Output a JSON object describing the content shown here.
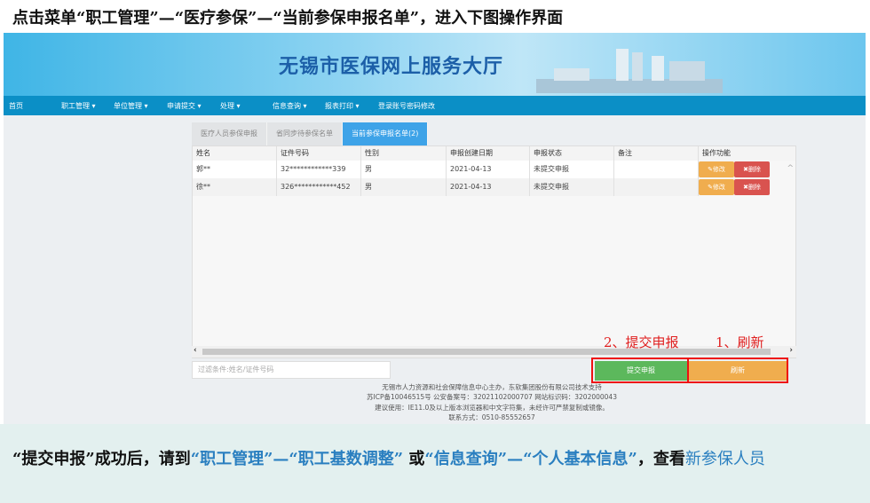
{
  "top_title": "点击菜单“职工管理”—“医疗参保”—“当前参保申报名单”，进入下图操作界面",
  "banner_title": "无锡市医保网上服务大厅",
  "nav": [
    "首页",
    "职工管理 ▾",
    "单位管理 ▾",
    "申请提交 ▾",
    "处理 ▾",
    "信息查询 ▾",
    "报表打印 ▾",
    "登录账号密码修改"
  ],
  "tabs": [
    "医疗人员参保申报",
    "省同步待参保名单",
    "当前参保申报名单(2)"
  ],
  "columns": [
    "姓名",
    "证件号码",
    "性别",
    "申报创建日期",
    "申报状态",
    "备注",
    "操作功能"
  ],
  "rows": [
    {
      "name": "郭**",
      "id": "32************339",
      "gender": "男",
      "date": "2021-04-13",
      "status": "未提交申报",
      "note": ""
    },
    {
      "name": "徐**",
      "id": "326************452",
      "gender": "男",
      "date": "2021-04-13",
      "status": "未提交申报",
      "note": ""
    }
  ],
  "edit_label": "✎修改",
  "delete_label": "✖删除",
  "filter_placeholder": "过滤条件:姓名/证件号码",
  "submit_label": "提交申报",
  "refresh_label": "刷新",
  "annot_submit": "2、提交申报",
  "annot_refresh": "1、刷新",
  "footer": [
    "无锡市人力资源和社会保障信息中心主办，东软集团股份有限公司技术支持",
    "苏ICP备10046515号  公安备案号：32021102000707   网站标识码：3202000043",
    "建议使用：IE11.0及以上版本浏览器和中文字符集，未经许可严禁复制或镜像。",
    "联系方式：0510-85552657"
  ],
  "caption": {
    "p1": "“提交申报”成功后，请到",
    "p2": "“职工管理”—“职工基数调整”",
    "p3": " 或",
    "p4": "“信息查询”—“个人基本信息”",
    "p5": "，查看",
    "p6": "新参保人员"
  },
  "colors": {
    "nav": "#0b8fc6",
    "tab_active": "#3ea3e8",
    "submit": "#5cb85c",
    "refresh": "#f0ad4e",
    "delete": "#d9534f",
    "highlight": "#2a7fc0"
  }
}
